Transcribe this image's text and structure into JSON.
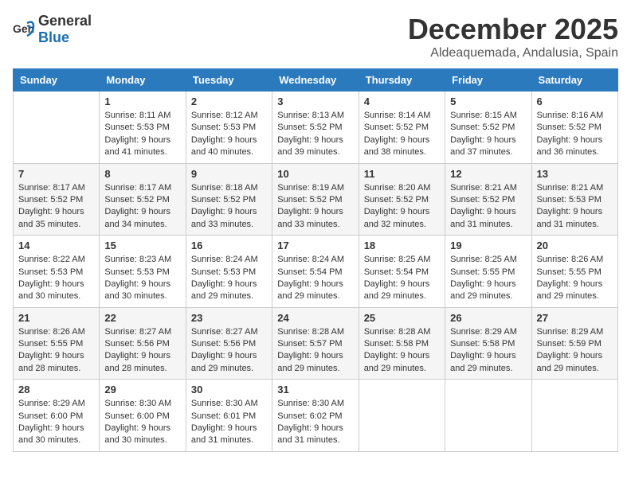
{
  "header": {
    "logo_general": "General",
    "logo_blue": "Blue",
    "month_title": "December 2025",
    "subtitle": "Aldeaquemada, Andalusia, Spain"
  },
  "weekdays": [
    "Sunday",
    "Monday",
    "Tuesday",
    "Wednesday",
    "Thursday",
    "Friday",
    "Saturday"
  ],
  "weeks": [
    [
      {
        "day": "",
        "info": ""
      },
      {
        "day": "1",
        "info": "Sunrise: 8:11 AM\nSunset: 5:53 PM\nDaylight: 9 hours\nand 41 minutes."
      },
      {
        "day": "2",
        "info": "Sunrise: 8:12 AM\nSunset: 5:53 PM\nDaylight: 9 hours\nand 40 minutes."
      },
      {
        "day": "3",
        "info": "Sunrise: 8:13 AM\nSunset: 5:52 PM\nDaylight: 9 hours\nand 39 minutes."
      },
      {
        "day": "4",
        "info": "Sunrise: 8:14 AM\nSunset: 5:52 PM\nDaylight: 9 hours\nand 38 minutes."
      },
      {
        "day": "5",
        "info": "Sunrise: 8:15 AM\nSunset: 5:52 PM\nDaylight: 9 hours\nand 37 minutes."
      },
      {
        "day": "6",
        "info": "Sunrise: 8:16 AM\nSunset: 5:52 PM\nDaylight: 9 hours\nand 36 minutes."
      }
    ],
    [
      {
        "day": "7",
        "info": "Sunrise: 8:17 AM\nSunset: 5:52 PM\nDaylight: 9 hours\nand 35 minutes."
      },
      {
        "day": "8",
        "info": "Sunrise: 8:17 AM\nSunset: 5:52 PM\nDaylight: 9 hours\nand 34 minutes."
      },
      {
        "day": "9",
        "info": "Sunrise: 8:18 AM\nSunset: 5:52 PM\nDaylight: 9 hours\nand 33 minutes."
      },
      {
        "day": "10",
        "info": "Sunrise: 8:19 AM\nSunset: 5:52 PM\nDaylight: 9 hours\nand 33 minutes."
      },
      {
        "day": "11",
        "info": "Sunrise: 8:20 AM\nSunset: 5:52 PM\nDaylight: 9 hours\nand 32 minutes."
      },
      {
        "day": "12",
        "info": "Sunrise: 8:21 AM\nSunset: 5:52 PM\nDaylight: 9 hours\nand 31 minutes."
      },
      {
        "day": "13",
        "info": "Sunrise: 8:21 AM\nSunset: 5:53 PM\nDaylight: 9 hours\nand 31 minutes."
      }
    ],
    [
      {
        "day": "14",
        "info": "Sunrise: 8:22 AM\nSunset: 5:53 PM\nDaylight: 9 hours\nand 30 minutes."
      },
      {
        "day": "15",
        "info": "Sunrise: 8:23 AM\nSunset: 5:53 PM\nDaylight: 9 hours\nand 30 minutes."
      },
      {
        "day": "16",
        "info": "Sunrise: 8:24 AM\nSunset: 5:53 PM\nDaylight: 9 hours\nand 29 minutes."
      },
      {
        "day": "17",
        "info": "Sunrise: 8:24 AM\nSunset: 5:54 PM\nDaylight: 9 hours\nand 29 minutes."
      },
      {
        "day": "18",
        "info": "Sunrise: 8:25 AM\nSunset: 5:54 PM\nDaylight: 9 hours\nand 29 minutes."
      },
      {
        "day": "19",
        "info": "Sunrise: 8:25 AM\nSunset: 5:55 PM\nDaylight: 9 hours\nand 29 minutes."
      },
      {
        "day": "20",
        "info": "Sunrise: 8:26 AM\nSunset: 5:55 PM\nDaylight: 9 hours\nand 29 minutes."
      }
    ],
    [
      {
        "day": "21",
        "info": "Sunrise: 8:26 AM\nSunset: 5:55 PM\nDaylight: 9 hours\nand 28 minutes."
      },
      {
        "day": "22",
        "info": "Sunrise: 8:27 AM\nSunset: 5:56 PM\nDaylight: 9 hours\nand 28 minutes."
      },
      {
        "day": "23",
        "info": "Sunrise: 8:27 AM\nSunset: 5:56 PM\nDaylight: 9 hours\nand 29 minutes."
      },
      {
        "day": "24",
        "info": "Sunrise: 8:28 AM\nSunset: 5:57 PM\nDaylight: 9 hours\nand 29 minutes."
      },
      {
        "day": "25",
        "info": "Sunrise: 8:28 AM\nSunset: 5:58 PM\nDaylight: 9 hours\nand 29 minutes."
      },
      {
        "day": "26",
        "info": "Sunrise: 8:29 AM\nSunset: 5:58 PM\nDaylight: 9 hours\nand 29 minutes."
      },
      {
        "day": "27",
        "info": "Sunrise: 8:29 AM\nSunset: 5:59 PM\nDaylight: 9 hours\nand 29 minutes."
      }
    ],
    [
      {
        "day": "28",
        "info": "Sunrise: 8:29 AM\nSunset: 6:00 PM\nDaylight: 9 hours\nand 30 minutes."
      },
      {
        "day": "29",
        "info": "Sunrise: 8:30 AM\nSunset: 6:00 PM\nDaylight: 9 hours\nand 30 minutes."
      },
      {
        "day": "30",
        "info": "Sunrise: 8:30 AM\nSunset: 6:01 PM\nDaylight: 9 hours\nand 31 minutes."
      },
      {
        "day": "31",
        "info": "Sunrise: 8:30 AM\nSunset: 6:02 PM\nDaylight: 9 hours\nand 31 minutes."
      },
      {
        "day": "",
        "info": ""
      },
      {
        "day": "",
        "info": ""
      },
      {
        "day": "",
        "info": ""
      }
    ]
  ]
}
